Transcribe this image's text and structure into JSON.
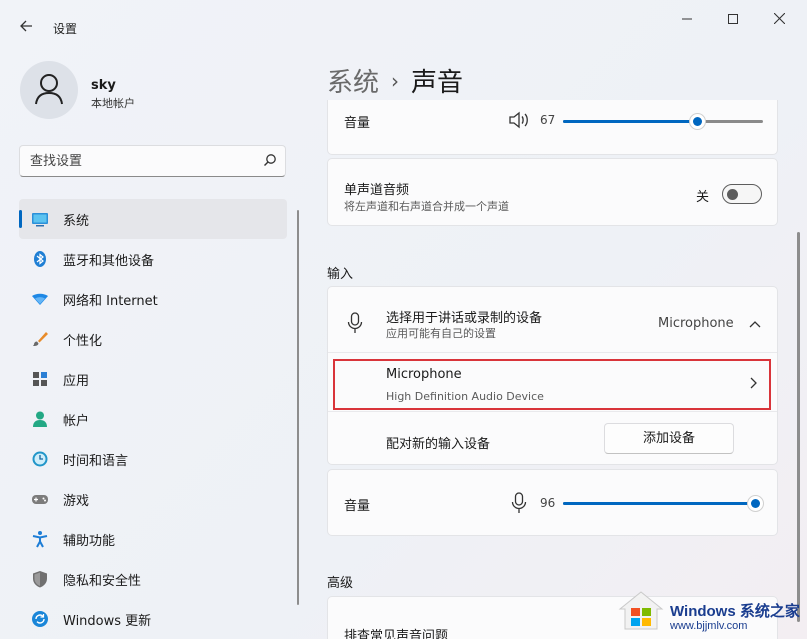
{
  "window": {
    "title": "设置",
    "controls": {
      "minimize": "—",
      "maximize": "☐",
      "close": "✕"
    }
  },
  "user": {
    "name": "sky",
    "account_type": "本地帐户"
  },
  "search": {
    "placeholder": "查找设置"
  },
  "sidebar": {
    "items": [
      {
        "label": "系统",
        "icon": "system-icon",
        "active": true
      },
      {
        "label": "蓝牙和其他设备",
        "icon": "bluetooth-icon"
      },
      {
        "label": "网络和 Internet",
        "icon": "network-icon"
      },
      {
        "label": "个性化",
        "icon": "brush-icon"
      },
      {
        "label": "应用",
        "icon": "apps-icon"
      },
      {
        "label": "帐户",
        "icon": "account-icon"
      },
      {
        "label": "时间和语言",
        "icon": "time-language-icon"
      },
      {
        "label": "游戏",
        "icon": "gaming-icon"
      },
      {
        "label": "辅助功能",
        "icon": "accessibility-icon"
      },
      {
        "label": "隐私和安全性",
        "icon": "shield-icon"
      },
      {
        "label": "Windows 更新",
        "icon": "windows-update-icon"
      }
    ]
  },
  "breadcrumb": {
    "parent": "系统",
    "separator": "›",
    "current": "声音"
  },
  "output": {
    "volume_label": "音量",
    "volume_value": "67",
    "volume_level": 67,
    "mono_title": "单声道音频",
    "mono_desc": "将左声道和右声道合并成一个声道",
    "mono_state": "关"
  },
  "input": {
    "section_title": "输入",
    "device_title": "选择用于讲话或录制的设备",
    "device_desc": "应用可能有自己的设置",
    "device_selected": "Microphone",
    "mic_name": "Microphone",
    "mic_desc": "High Definition Audio Device",
    "pair_label": "配对新的输入设备",
    "add_button": "添加设备",
    "volume_label": "音量",
    "volume_value": "96",
    "volume_level": 96
  },
  "advanced": {
    "section_title": "高级",
    "troubleshoot": "排查常见声音问题"
  },
  "watermark": {
    "title": "Windows 系统之家",
    "url": "www.bjjmlv.com"
  },
  "colors": {
    "accent": "#0067c0",
    "highlight": "#d9343a"
  }
}
